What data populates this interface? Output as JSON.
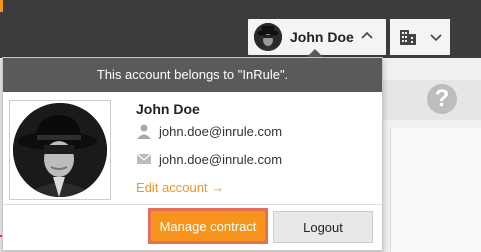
{
  "topbar": {
    "user_name": "John Doe"
  },
  "panel": {
    "header": "This account belongs to \"InRule\".",
    "name": "John Doe",
    "username": "john.doe@inrule.com",
    "email": "john.doe@inrule.com",
    "edit_account": "Edit account →",
    "manage_contract": "Manage contract",
    "logout": "Logout"
  },
  "help": {
    "label": "?"
  },
  "colors": {
    "accent": "#f7941d",
    "header_bg": "#5a5a5a",
    "topbar_bg": "#3c3c3c"
  },
  "icons": {
    "user": "user-icon",
    "mail": "mail-icon",
    "building": "building-icon",
    "chevron_up": "chevron-up-icon",
    "chevron_down": "chevron-down-icon",
    "help": "help-icon"
  }
}
